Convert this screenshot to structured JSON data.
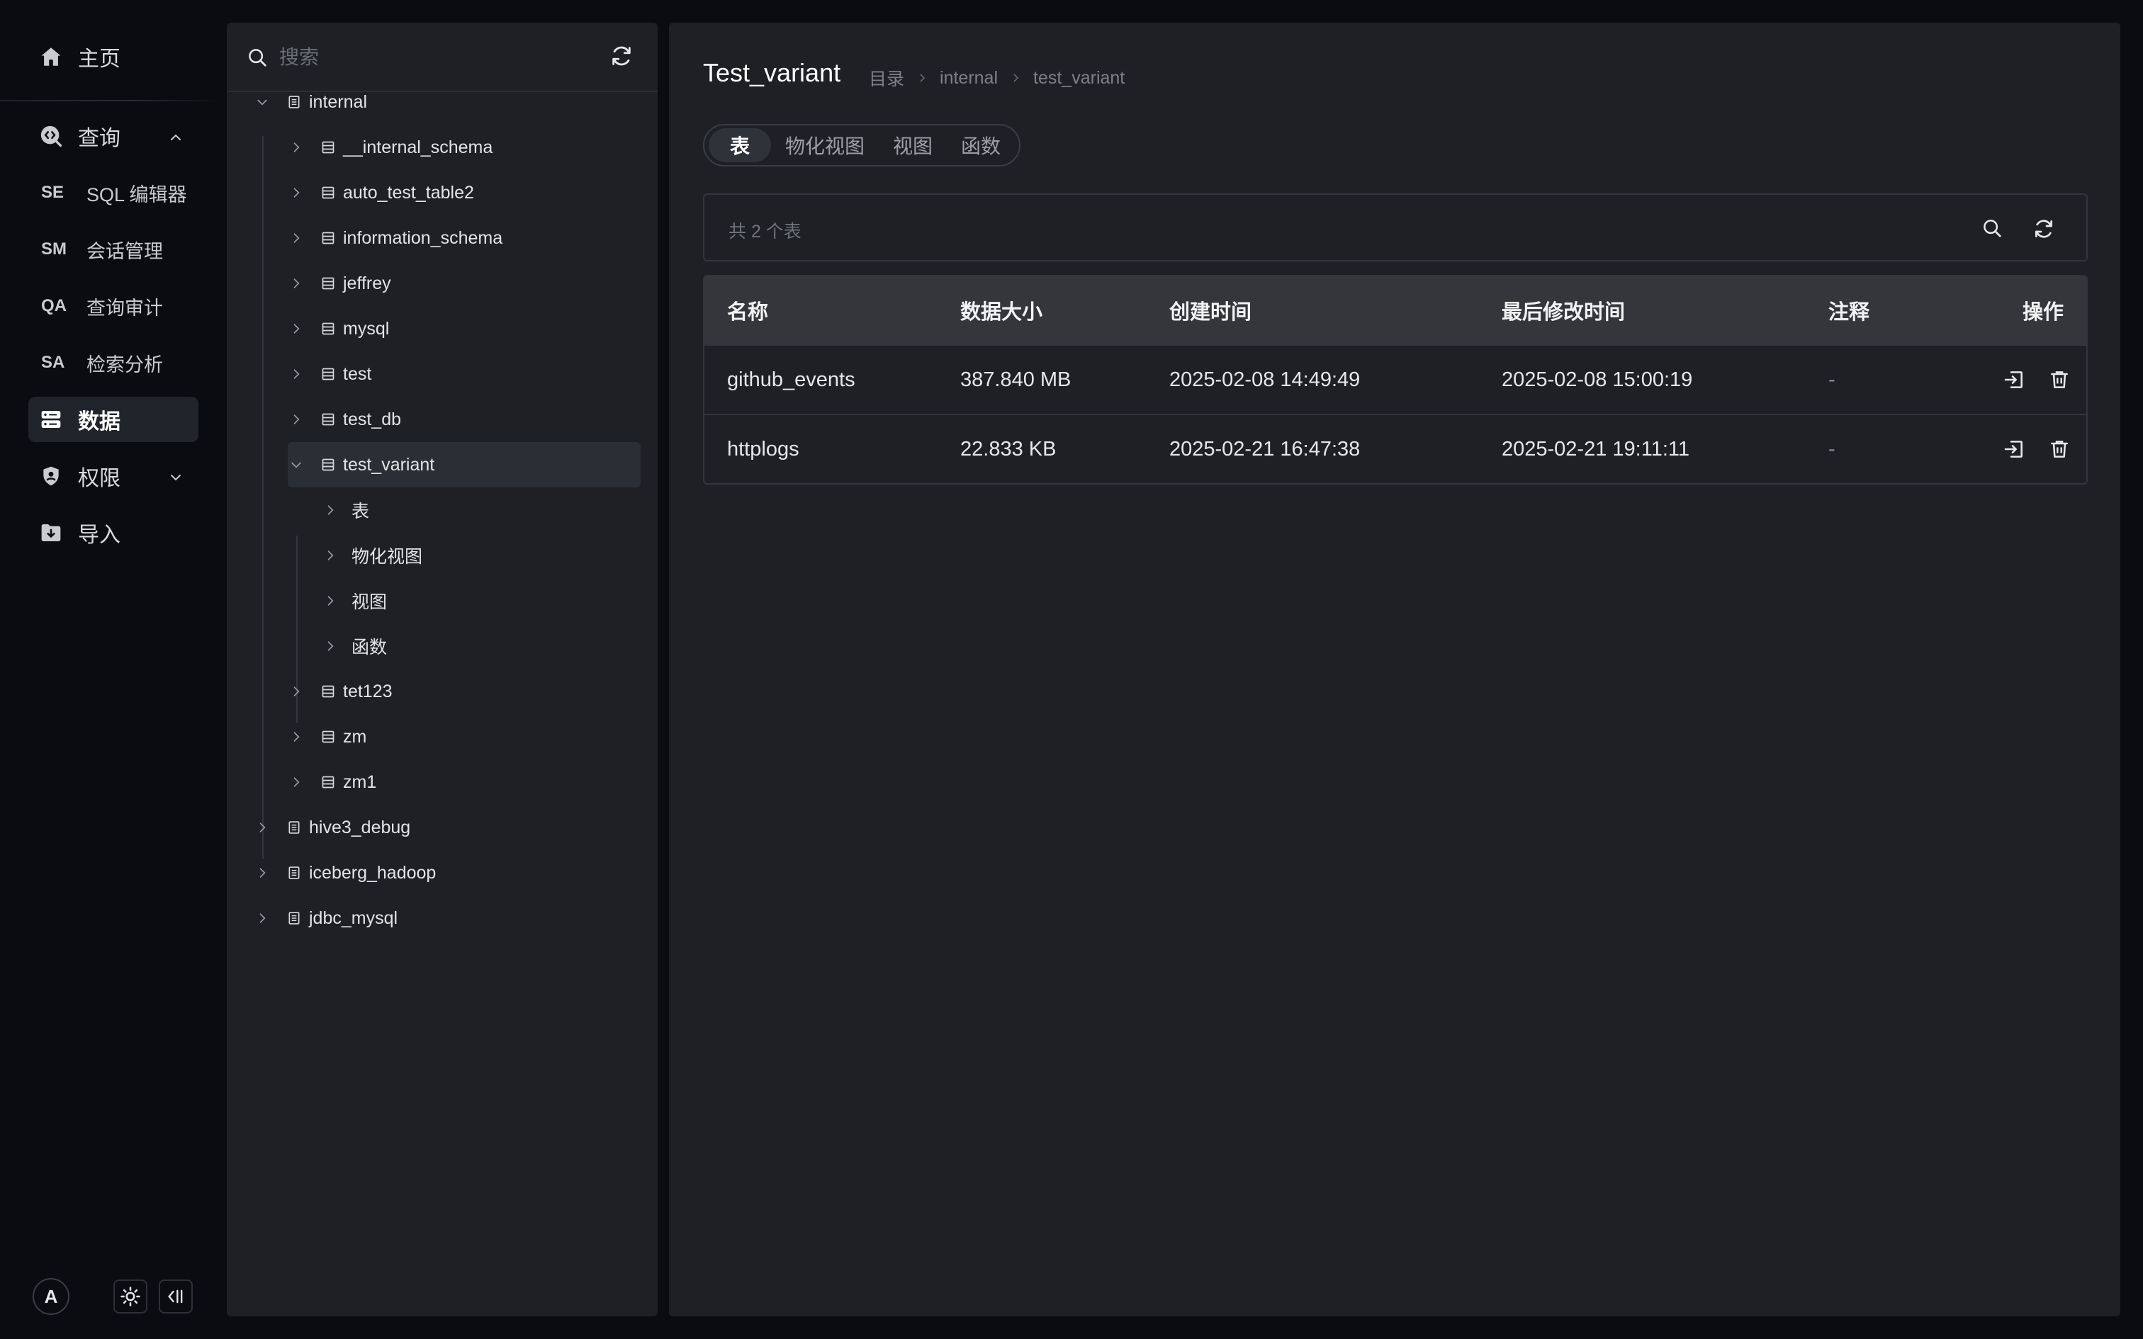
{
  "nav": {
    "home": "主页",
    "query": "查询",
    "query_items": [
      {
        "abbr": "SE",
        "label": "SQL 编辑器"
      },
      {
        "abbr": "SM",
        "label": "会话管理"
      },
      {
        "abbr": "QA",
        "label": "查询审计"
      },
      {
        "abbr": "SA",
        "label": "检索分析"
      }
    ],
    "data": "数据",
    "permissions": "权限",
    "import": "导入",
    "avatar": "A"
  },
  "tree": {
    "search_placeholder": "搜索",
    "catalogs": [
      "internal",
      "hive3_debug",
      "iceberg_hadoop",
      "jdbc_mysql"
    ],
    "databases": [
      "__internal_schema",
      "auto_test_table2",
      "information_schema",
      "jeffrey",
      "mysql",
      "test",
      "test_db",
      "test_variant",
      "tet123",
      "zm",
      "zm1"
    ],
    "categories": [
      "表",
      "物化视图",
      "视图",
      "函数"
    ]
  },
  "main": {
    "title": "Test_variant",
    "breadcrumb": [
      "目录",
      "internal",
      "test_variant"
    ],
    "tabs": [
      "表",
      "物化视图",
      "视图",
      "函数"
    ],
    "count_text": "共 2 个表",
    "columns": [
      "名称",
      "数据大小",
      "创建时间",
      "最后修改时间",
      "注释",
      "操作"
    ],
    "rows": [
      {
        "name": "github_events",
        "size": "387.840 MB",
        "created": "2025-02-08 14:49:49",
        "modified": "2025-02-08 15:00:19",
        "comment": "-"
      },
      {
        "name": "httplogs",
        "size": "22.833 KB",
        "created": "2025-02-21 16:47:38",
        "modified": "2025-02-21 19:11:11",
        "comment": "-"
      }
    ]
  }
}
